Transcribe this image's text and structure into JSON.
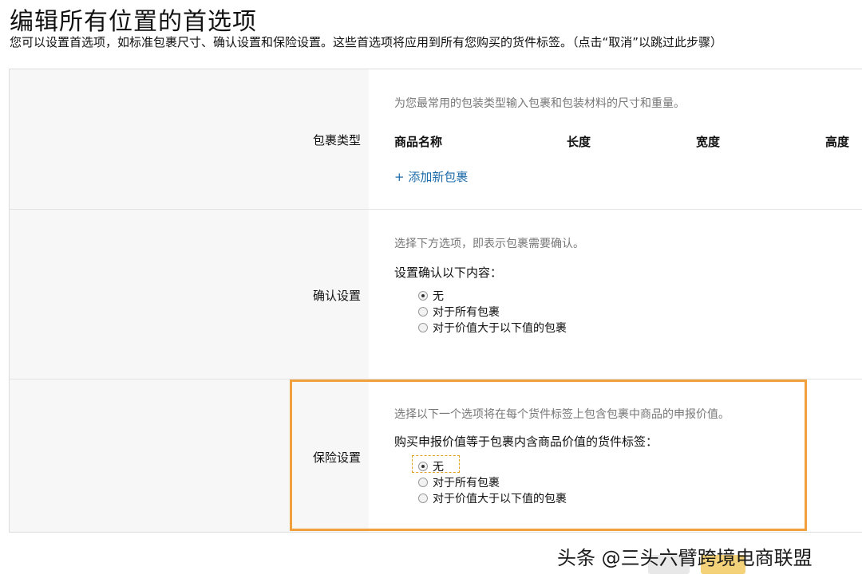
{
  "title": "编辑所有位置的首选项",
  "subtitle": "您可以设置首选项，如标准包裹尺寸、确认设置和保险设置。这些首选项将应用到所有您购买的货件标签。（点击“取消”以跳过此步骤）",
  "package_section": {
    "label": "包裹类型",
    "description": "为您最常用的包装类型输入包裹和包装材料的尺寸和重量。",
    "columns": [
      "商品名称",
      "长度",
      "宽度",
      "高度"
    ],
    "add_link": "+ 添加新包裹"
  },
  "confirmation_section": {
    "label": "确认设置",
    "description": "选择下方选项，即表示包裹需要确认。",
    "question": "设置确认以下内容：",
    "options": [
      {
        "label": "无",
        "checked": true
      },
      {
        "label": "对于所有包裹",
        "checked": false
      },
      {
        "label": "对于价值大于以下值的包裹",
        "checked": false
      }
    ]
  },
  "insurance_section": {
    "label": "保险设置",
    "description": "选择以下一个选项将在每个货件标签上包含包裹中商品的申报价值。",
    "question": "购买申报价值等于包裹内含商品价值的货件标签：",
    "options": [
      {
        "label": "无",
        "checked": true
      },
      {
        "label": "对于所有包裹",
        "checked": false
      },
      {
        "label": "对于价值大于以下值的包裹",
        "checked": false
      }
    ]
  },
  "watermark": "头条 @三头六臂跨境电商联盟",
  "colors": {
    "highlight": "#f0a03c",
    "link": "#1d6ba8",
    "left_column_bg": "#f7f7f7"
  }
}
